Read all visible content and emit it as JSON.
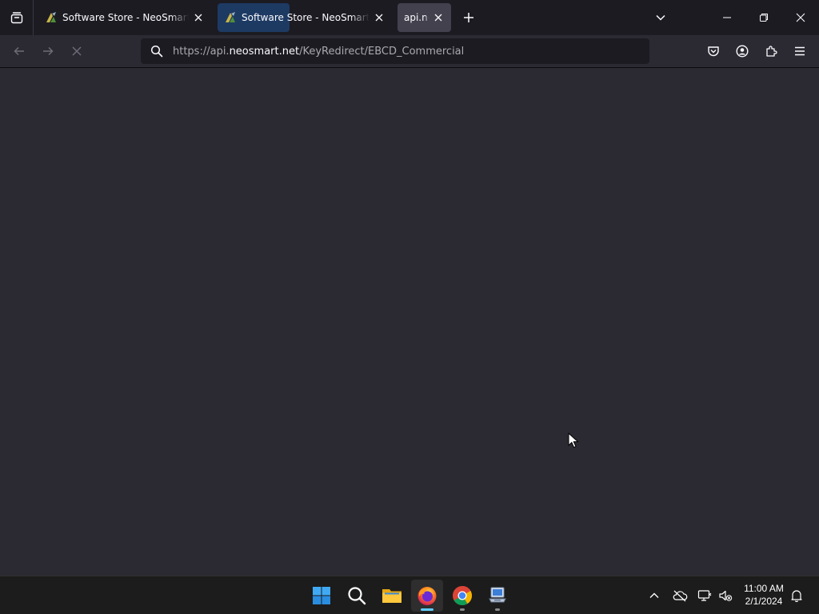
{
  "browser": {
    "tabs": [
      {
        "title": "Software Store - NeoSmart Technologies",
        "state": "background"
      },
      {
        "title": "Software Store - NeoSmart Technologies",
        "state": "hovered"
      },
      {
        "title": "api.neosmart.net",
        "state": "selected"
      }
    ],
    "url": {
      "prefix": "https://api.",
      "domain": "neosmart.net",
      "path": "/KeyRedirect/EBCD_Commercial"
    },
    "loading": true
  },
  "taskbar": {
    "apps": [
      "start-icon",
      "search-icon",
      "file-explorer-icon",
      "firefox-icon",
      "chrome-icon",
      "remote-desktop-icon"
    ],
    "active_app": "firefox-icon",
    "clock": {
      "time": "11:00 AM",
      "date": "2/1/2024"
    }
  },
  "colors": {
    "tabstrip_bg": "#1c1b22",
    "toolbar_bg": "#2b2a33",
    "selected_tab_bg": "#42414d",
    "urlbar_bg": "#1c1b22",
    "taskbar_bg": "#1c1c1c",
    "accent": "#60cdff"
  }
}
